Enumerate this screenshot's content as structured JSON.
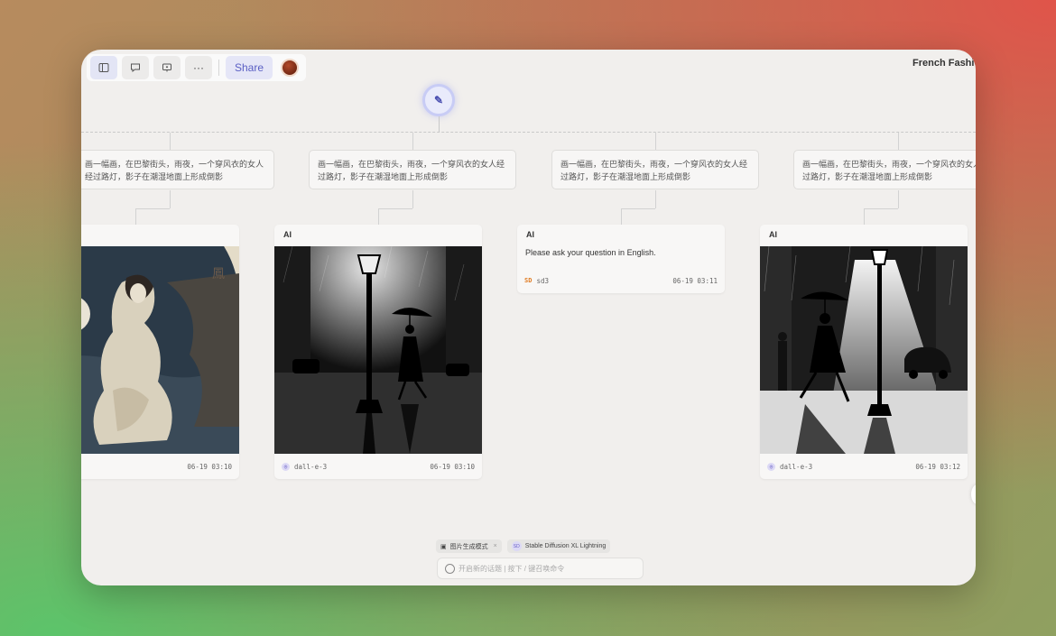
{
  "toolbar": {
    "share_label": "Share",
    "icons": [
      "sidebar-icon",
      "comment-icon",
      "present-icon",
      "more-icon"
    ],
    "more_glyph": "···"
  },
  "document": {
    "title": "French Fashi"
  },
  "root": {
    "glyph": "✎"
  },
  "prompt_text": "画一幅画，在巴黎街头，雨夜，一个穿风衣的女人经过路灯，影子在潮湿地面上形成倒影",
  "columns": [
    {
      "prompt": "画一幅画，在巴黎街头，雨夜，一个穿风衣的女人经过路灯，影子在潮湿地面上形成倒影",
      "result": {
        "kind": "image",
        "header": "",
        "model": "",
        "time": "06-19 03:10"
      }
    },
    {
      "prompt": "画一幅画，在巴黎街头，雨夜，一个穿风衣的女人经过路灯，影子在潮湿地面上形成倒影",
      "result": {
        "kind": "image",
        "header": "AI",
        "model": "dall-e-3",
        "time": "06-19 03:10"
      }
    },
    {
      "prompt": "画一幅画，在巴黎街头，雨夜，一个穿风衣的女人经过路灯，影子在潮湿地面上形成倒影",
      "result": {
        "kind": "text",
        "header": "AI",
        "text": "Please ask your question in English.",
        "model_badge": "SD",
        "model": "sd3",
        "time": "06-19 03:11"
      }
    },
    {
      "prompt": "画一幅画，在巴黎街头，雨夜，一个穿风衣的女人经过路灯，影子在潮湿地面上形成倒影",
      "result": {
        "kind": "image",
        "header": "AI",
        "model": "dall-e-3",
        "time": "06-19 03:12"
      }
    }
  ],
  "bottom": {
    "mode_tag": "图片生成模式",
    "model_badge": "SD",
    "model_tag": "Stable Diffusion XL Lightning",
    "close_glyph": "×",
    "input_placeholder": "开启新的话题 | 按下 / 键召唤命令"
  },
  "colors": {
    "accent": "#5a5fc4",
    "window_bg": "#f1efed"
  }
}
